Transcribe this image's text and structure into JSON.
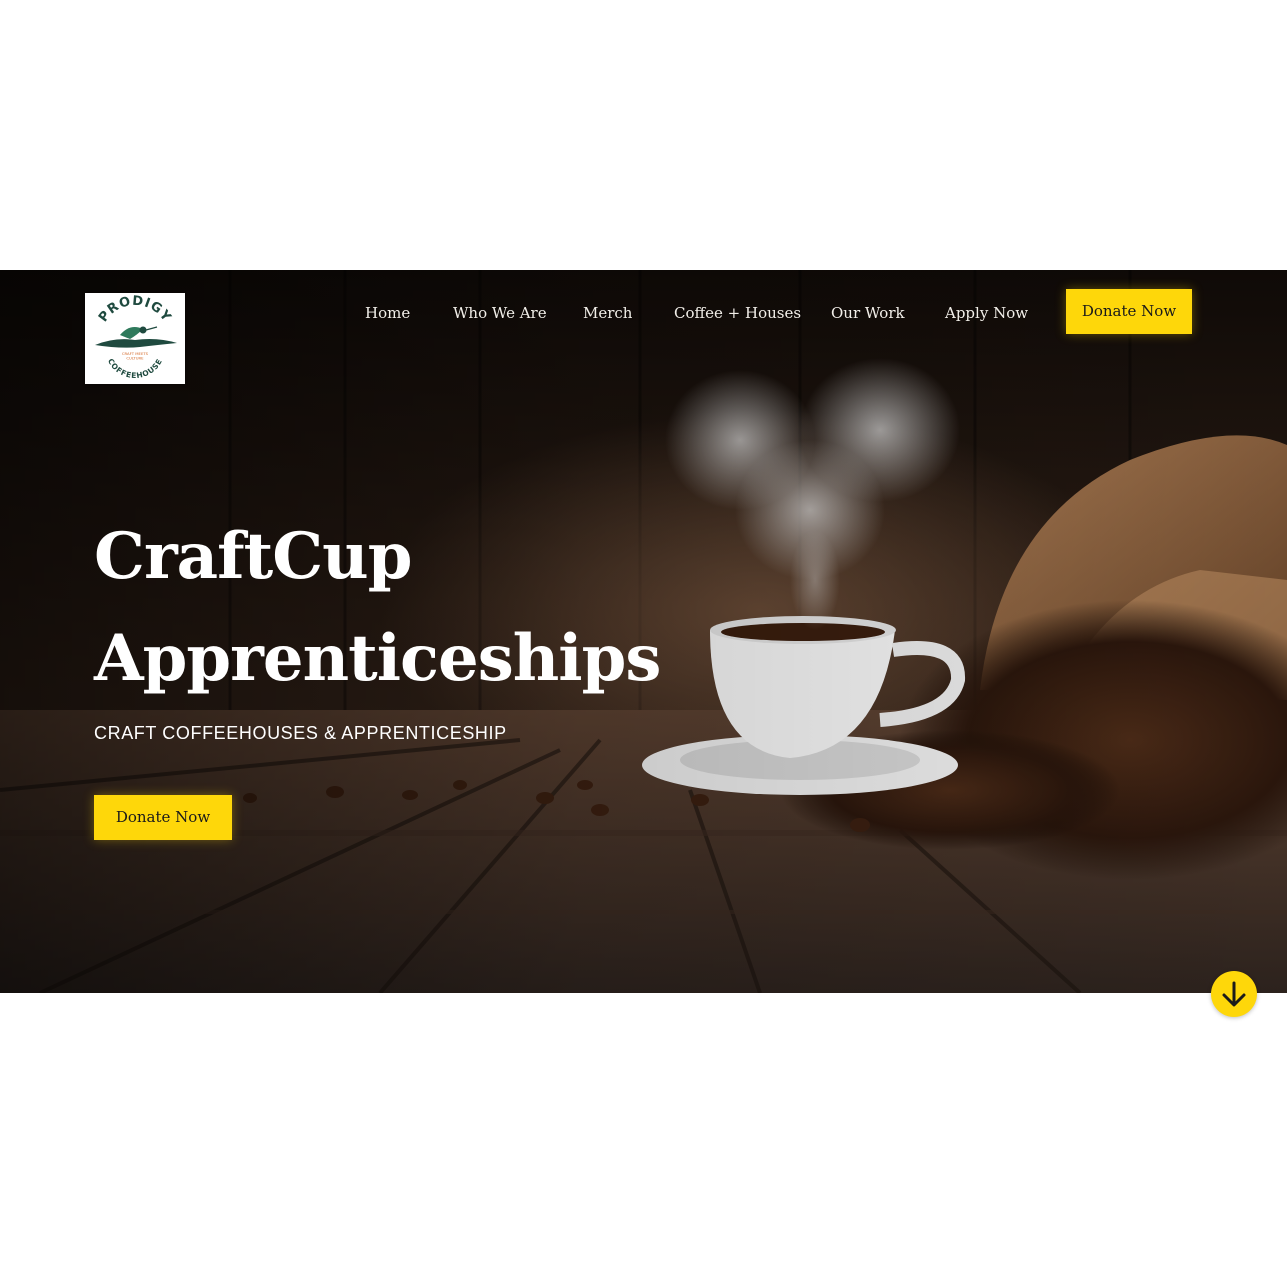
{
  "brand": {
    "logo_name": "PRODIGY",
    "logo_subname": "COFFEEHOUSE",
    "logo_tagline_1": "CRAFT MEETS",
    "logo_tagline_2": "CULTURE",
    "logo_icon": "hummingbird-icon"
  },
  "nav": {
    "items": [
      {
        "label": "Home"
      },
      {
        "label": "Who We Are"
      },
      {
        "label": "Merch"
      },
      {
        "label": "Coffee + Houses"
      },
      {
        "label": "Our Work"
      },
      {
        "label": "Apply Now"
      }
    ],
    "donate_label": "Donate Now"
  },
  "hero": {
    "title_line1": "CraftCup",
    "title_line2": "Apprenticeships",
    "subtitle": "CRAFT COFFEEHOUSES & APPRENTICESHIP",
    "donate_label": "Donate Now",
    "scroll_icon": "arrow-down-icon"
  },
  "colors": {
    "accent": "#fed70a",
    "hero_text": "#ffffff",
    "logo_green": "#1f4a3f",
    "logo_orange": "#d46a2a"
  }
}
